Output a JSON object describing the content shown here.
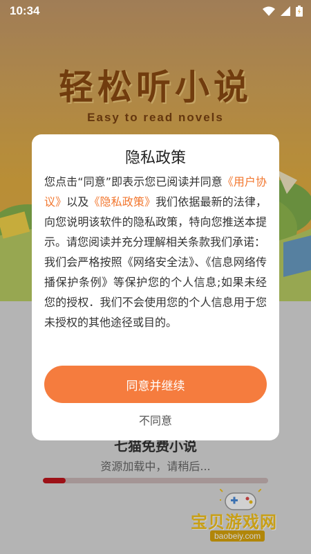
{
  "status_bar": {
    "time": "10:34"
  },
  "splash": {
    "title": "轻松听小说",
    "subtitle": "Easy to read novels"
  },
  "loading": {
    "title": "七猫免费小说",
    "message": "资源加载中，请稍后...",
    "progress": 0.1
  },
  "watermark": {
    "text": "宝贝游戏网",
    "url": "baobeiy.com"
  },
  "dialog": {
    "title": "隐私政策",
    "body_1": "您点击“同意”即表示您已阅读并同意",
    "link_user_agreement": "《用户协议》",
    "body_2": "以及",
    "link_privacy_policy": "《隐私政策》",
    "body_3": "我们依据最新的法律，向您说明该软件的隐私政策，特向您推送本提示。请您阅读并充分理解相关条款我们承诺：",
    "body_4": "我们会严格按照《网络安全法》、《信息网络传播保护条例》等保护您的个人信息;如果未经您的授权．我们不会使用您的个人信息用于您未授权的其他途径或目的。",
    "agree_label": "同意并继续",
    "disagree_label": "不同意"
  },
  "colors": {
    "accent": "#f57c3e",
    "link": "#f2772f",
    "title_brown": "#8a4a12",
    "progress": "#c0151d"
  }
}
